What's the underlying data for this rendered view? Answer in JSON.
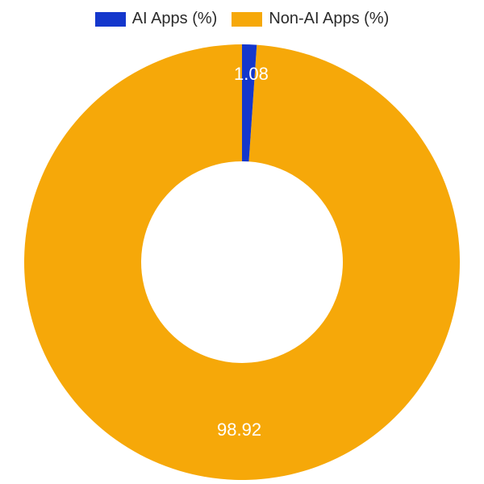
{
  "chart_data": {
    "type": "pie",
    "donut": true,
    "series": [
      {
        "name": "AI Apps (%)",
        "value": 1.08,
        "color": "#1437cc"
      },
      {
        "name": "Non-AI Apps (%)",
        "value": 98.92,
        "color": "#f6a809"
      }
    ],
    "value_labels": [
      "1.08",
      "98.92"
    ],
    "legend_position": "top"
  },
  "legend": {
    "items": [
      {
        "label": "AI Apps (%)",
        "color": "#1437cc"
      },
      {
        "label": "Non-AI Apps (%)",
        "color": "#f6a809"
      }
    ]
  },
  "labels": {
    "small": "1.08",
    "large": "98.92"
  }
}
